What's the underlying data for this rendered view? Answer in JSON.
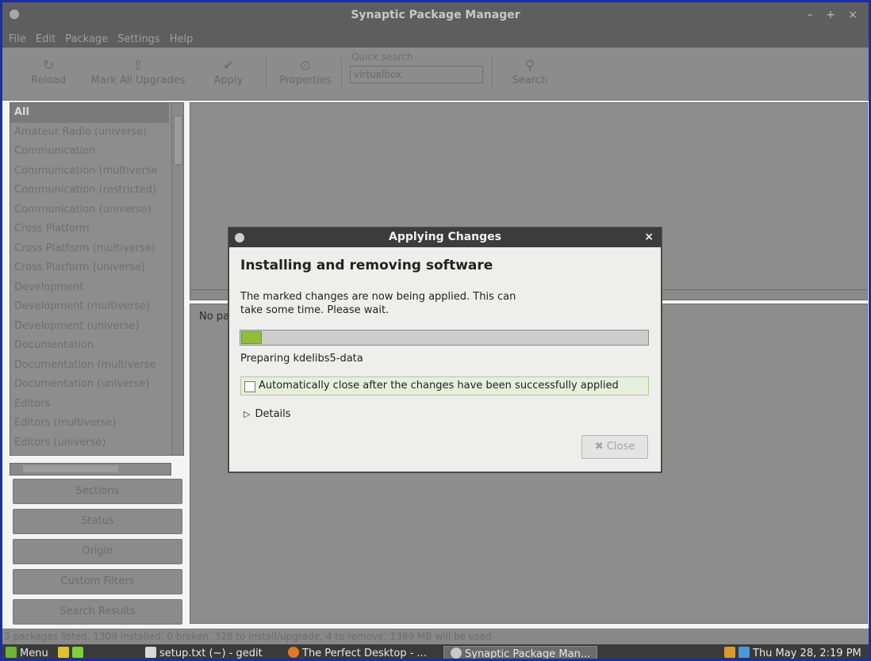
{
  "window": {
    "title": "Synaptic Package Manager",
    "controls": "– + ×"
  },
  "menu": [
    "File",
    "Edit",
    "Package",
    "Settings",
    "Help"
  ],
  "toolbar": {
    "reload": "Reload",
    "mark_all": "Mark All Upgrades",
    "apply": "Apply",
    "properties": "Properties",
    "quick_search_label": "Quick search",
    "quick_search_value": "virtualbox",
    "search": "Search"
  },
  "sections": [
    "All",
    "Amateur Radio (universe)",
    "Communication",
    "Communication (multiverse",
    "Communication (restricted)",
    "Communication (universe)",
    "Cross Platform",
    "Cross Platform (multiverse)",
    "Cross Platform (universe)",
    "Development",
    "Development (multiverse)",
    "Development (universe)",
    "Documentation",
    "Documentation (multiverse",
    "Documentation (universe)",
    "Editors",
    "Editors (multiverse)",
    "Editors (universe)"
  ],
  "filters": {
    "sections": "Sections",
    "status": "Status",
    "origin": "Origin",
    "custom": "Custom Filters",
    "search_results": "Search Results"
  },
  "details_pane": {
    "no_package": "No pa"
  },
  "statusbar": "3 packages listed, 1309 installed, 0 broken. 328 to install/upgrade, 4 to remove; 1389 MB will be used",
  "dialog": {
    "title": "Applying Changes",
    "close_glyph": "×",
    "heading": "Installing and removing software",
    "message_line1": "The marked changes are now being applied. This can",
    "message_line2": "take some time. Please wait.",
    "progress": 0.05,
    "status": "Preparing kdelibs5-data",
    "auto_close_label": "Automatically close after the changes have been successfully applied",
    "auto_close_checked": false,
    "details": "Details",
    "close_button": "Close"
  },
  "taskbar": {
    "menu": "Menu",
    "gedit": "setup.txt (~) - gedit",
    "firefox": "The Perfect Desktop - ...",
    "synaptic": "Synaptic Package Man...",
    "clock": "Thu May 28,  2:19 PM"
  },
  "colors": {
    "dialog_titlebar": "#3c3c3c",
    "progress_fill": "#8fbf3a",
    "taskbar": "#3a3a3a",
    "dimmed_background": "#8d8d8d"
  },
  "icons": [
    "app-icon",
    "reload-icon",
    "mark-upgrades-icon",
    "apply-icon",
    "properties-icon",
    "search-icon",
    "checkbox-icon",
    "expander-arrow-icon",
    "close-icon"
  ]
}
